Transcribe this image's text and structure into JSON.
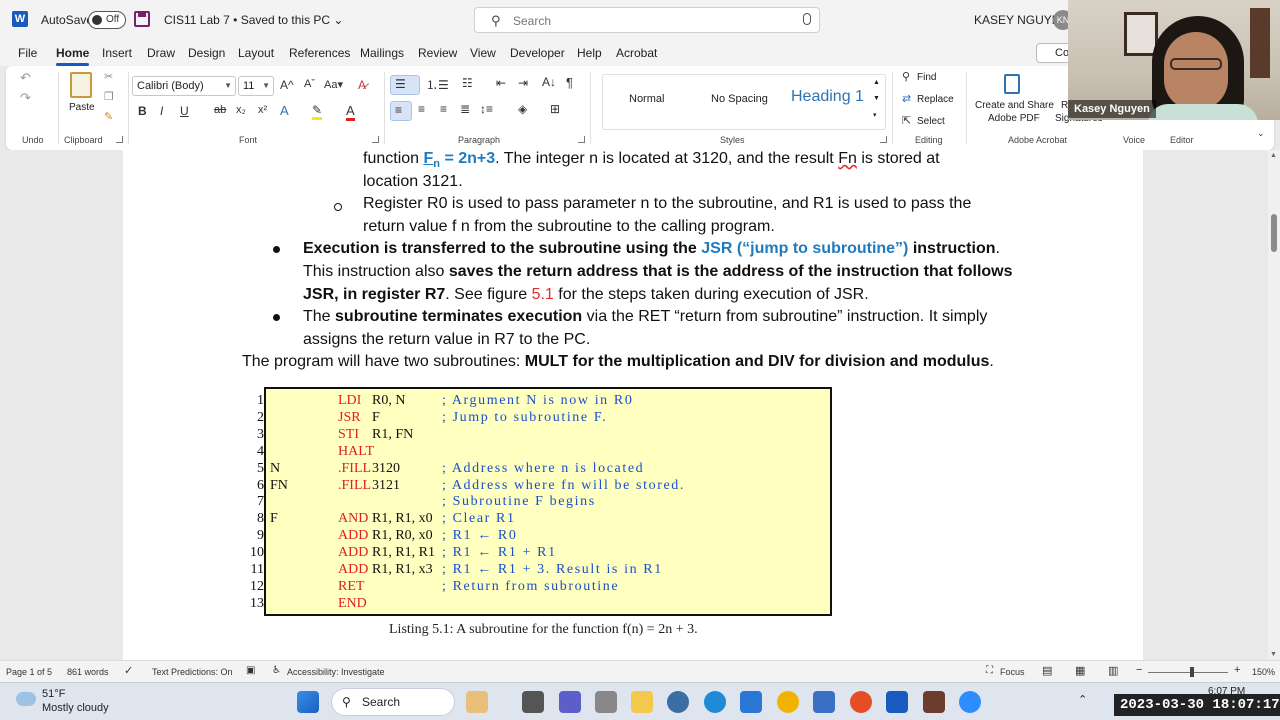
{
  "titlebar": {
    "autosave_label": "AutoSave",
    "autosave_state": "Off",
    "doc_title": "CIS11 Lab 7 • Saved to this PC ⌄",
    "search_placeholder": "Search",
    "user_name": "KASEY NGUYEN",
    "user_initials": "KN"
  },
  "menu": {
    "tabs": [
      "File",
      "Home",
      "Insert",
      "Draw",
      "Design",
      "Layout",
      "References",
      "Mailings",
      "Review",
      "View",
      "Developer",
      "Help",
      "Acrobat"
    ],
    "active": "Home",
    "comments_label": "Co"
  },
  "ribbon": {
    "groups": [
      "Undo",
      "Clipboard",
      "Font",
      "Paragraph",
      "Styles",
      "Editing",
      "Adobe Acrobat",
      "Voice",
      "Editor"
    ],
    "paste_label": "Paste",
    "font_name": "Calibri (Body)",
    "font_size": "11",
    "styles": [
      "Normal",
      "No Spacing",
      "Heading 1"
    ],
    "find": "Find",
    "replace": "Replace",
    "select": "Select",
    "acrobat_line1": "Create and Share",
    "acrobat_line2": "Adobe PDF",
    "signatures_line1": "R",
    "signatures_line2": "Signatures"
  },
  "webcam": {
    "name": "Kasey Nguyen"
  },
  "document": {
    "line1_a": "function ",
    "line1_fn": "F",
    "line1_sub": "n",
    "line1_eq": " = 2n+3",
    "line1_b": ". The integer n is located at 3120, and the result ",
    "line1_fn2": "Fn",
    "line1_c": " is stored at",
    "line2": "location 3121.",
    "line3": "Register R0 is used to pass parameter n to the subroutine, and R1 is used to pass the",
    "line4": "return value f n from the subroutine to the calling program.",
    "b1_l1_bold": "Execution is transferred to the subroutine using the ",
    "b1_l1_blue": "JSR (“jump to subroutine”)",
    "b1_l1_bold2": " instruction",
    "b1_l1_end": ".",
    "b1_l2_a": "This instruction also ",
    "b1_l2_bold": "saves the return address that is the address of the instruction that follows",
    "b1_l3_bold": "JSR, in register R7",
    "b1_l3_a": ". See figure ",
    "b1_l3_red": "5.1",
    "b1_l3_b": " for the steps taken during execution of JSR.",
    "b2_l1_a": "The ",
    "b2_l1_bold": "subroutine terminates execution",
    "b2_l1_b": " via the RET “return from subroutine” instruction. It simply",
    "b2_l2": "assigns the return value in R7 to the PC.",
    "summary_a": "The program will have two subroutines: ",
    "summary_bold": "MULT for the multiplication and DIV for division and modulus",
    "summary_end": ".",
    "caption": "Listing 5.1: A subroutine for the function f(n) = 2n + 3."
  },
  "listing": [
    {
      "num": "1",
      "label": "",
      "op": "LDI",
      "args": "R0, N",
      "comment": "; Argument N is now in R0"
    },
    {
      "num": "2",
      "label": "",
      "op": "JSR",
      "args": "F",
      "comment": "; Jump to subroutine F."
    },
    {
      "num": "3",
      "label": "",
      "op": "STI",
      "args": "R1, FN",
      "comment": ""
    },
    {
      "num": "4",
      "label": "",
      "op": "HALT",
      "args": "",
      "comment": ""
    },
    {
      "num": "5",
      "label": "N",
      "op": ".FILL",
      "args": "3120",
      "comment": "; Address where n is located"
    },
    {
      "num": "6",
      "label": "FN",
      "op": ".FILL",
      "args": "3121",
      "comment": "; Address where fn will be stored."
    },
    {
      "num": "7",
      "label": "",
      "op": "",
      "args": "",
      "comment": "; Subroutine F begins"
    },
    {
      "num": "8",
      "label": "F",
      "op": "AND",
      "args": "R1, R1, x0",
      "comment": "; Clear R1"
    },
    {
      "num": "9",
      "label": "",
      "op": "ADD",
      "args": "R1, R0, x0",
      "comment": "; R1 ← R0"
    },
    {
      "num": "10",
      "label": "",
      "op": "ADD",
      "args": "R1, R1, R1",
      "comment": "; R1 ← R1 + R1"
    },
    {
      "num": "11",
      "label": "",
      "op": "ADD",
      "args": "R1, R1, x3",
      "comment": "; R1 ← R1 + 3.  Result is in R1"
    },
    {
      "num": "12",
      "label": "",
      "op": "RET",
      "args": "",
      "comment": "; Return from subroutine"
    },
    {
      "num": "13",
      "label": "",
      "op": "END",
      "args": "",
      "comment": ""
    }
  ],
  "status": {
    "page": "Page 1 of 5",
    "words": "861 words",
    "predictions": "Text Predictions: On",
    "accessibility": "Accessibility: Investigate",
    "focus": "Focus",
    "zoom": "150%"
  },
  "taskbar": {
    "temp": "51°F",
    "condition": "Mostly cloudy",
    "search_label": "Search",
    "time": "6:07 PM",
    "timestamp": "2023-03-30 18:07:17"
  }
}
